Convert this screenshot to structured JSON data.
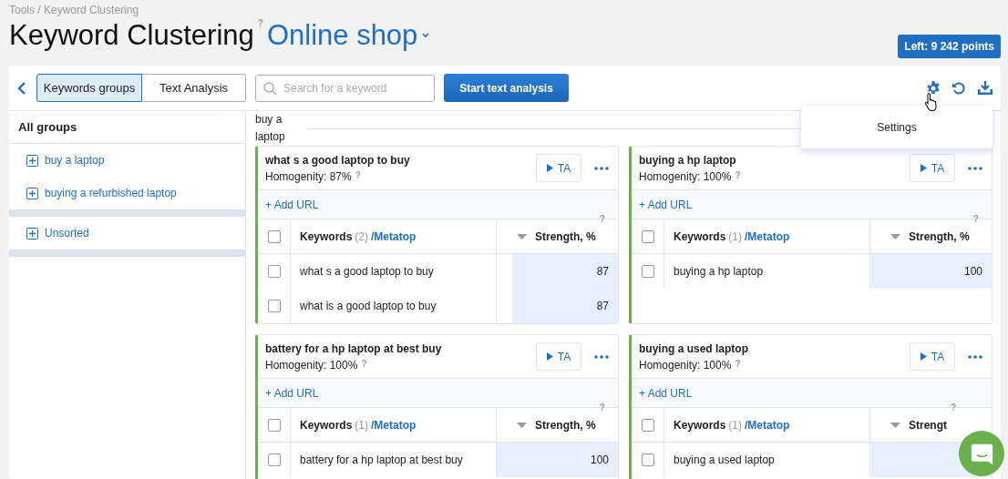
{
  "breadcrumb": "Tools / Keyword Clustering",
  "title": "Keyword Clustering",
  "title_help": "?",
  "project": "Online shop",
  "points_badge": "Left: 9 242 points",
  "toolbar": {
    "tabs": [
      {
        "label": "Keywords groups",
        "selected": true
      },
      {
        "label": "Text Analysis",
        "selected": false
      }
    ],
    "search": {
      "placeholder": "Search for a keyword"
    },
    "start_button": "Start text analysis"
  },
  "settings_menu": [
    "Settings"
  ],
  "sidebar": {
    "header": "All groups",
    "sections": [
      {
        "items": [
          "buy a laptop",
          "buying a refurbished laptop"
        ]
      },
      {
        "items": [
          "Unsorted"
        ]
      }
    ]
  },
  "group_heading": "buy a laptop",
  "clusters": [
    {
      "title": "what s a good laptop to buy",
      "homogeneity": "Homogenity: 87%",
      "help": "?",
      "ta_button": "TA",
      "add_url": "+ Add URL",
      "all_checked": false,
      "columns": {
        "keywords": "Keywords",
        "count": "(2)",
        "metatop": "/Metatop",
        "strength": "Strength, %",
        "help": "?"
      },
      "rows": [
        {
          "keyword": "what s a good laptop to buy",
          "strength": "87",
          "level": 0.87,
          "checked": false
        },
        {
          "keyword": "what is a good laptop to buy",
          "strength": "87",
          "level": 0.87,
          "checked": false
        }
      ]
    },
    {
      "title": "buying a hp laptop",
      "homogeneity": "Homogenity: 100%",
      "help": "?",
      "ta_button": "TA",
      "add_url": "+ Add URL",
      "all_checked": false,
      "columns": {
        "keywords": "Keywords",
        "count": "(1)",
        "metatop": "/Metatop",
        "strength": "Strength, %",
        "help": "?"
      },
      "rows": [
        {
          "keyword": "buying a hp laptop",
          "strength": "100",
          "level": 1,
          "checked": false
        }
      ]
    },
    {
      "title": "battery for a hp laptop at best buy",
      "homogeneity": "Homogenity: 100%",
      "help": "?",
      "ta_button": "TA",
      "add_url": "+ Add URL",
      "all_checked": false,
      "columns": {
        "keywords": "Keywords",
        "count": "(1)",
        "metatop": "/Metatop",
        "strength": "Strength, %",
        "help": "?"
      },
      "rows": [
        {
          "keyword": "battery for a hp laptop at best buy",
          "strength": "100",
          "level": 1,
          "checked": false
        }
      ]
    },
    {
      "title": "buying a used laptop",
      "homogeneity": "Homogenity: 100%",
      "help": "?",
      "ta_button": "TA",
      "add_url": "+ Add URL",
      "all_checked": false,
      "columns": {
        "keywords": "Keywords",
        "count": "(1)",
        "metatop": "/Metatop",
        "strength": "Strengt",
        "help": "?"
      },
      "rows": [
        {
          "keyword": "buying a used laptop",
          "level": 1,
          "checked": false
        }
      ]
    }
  ]
}
